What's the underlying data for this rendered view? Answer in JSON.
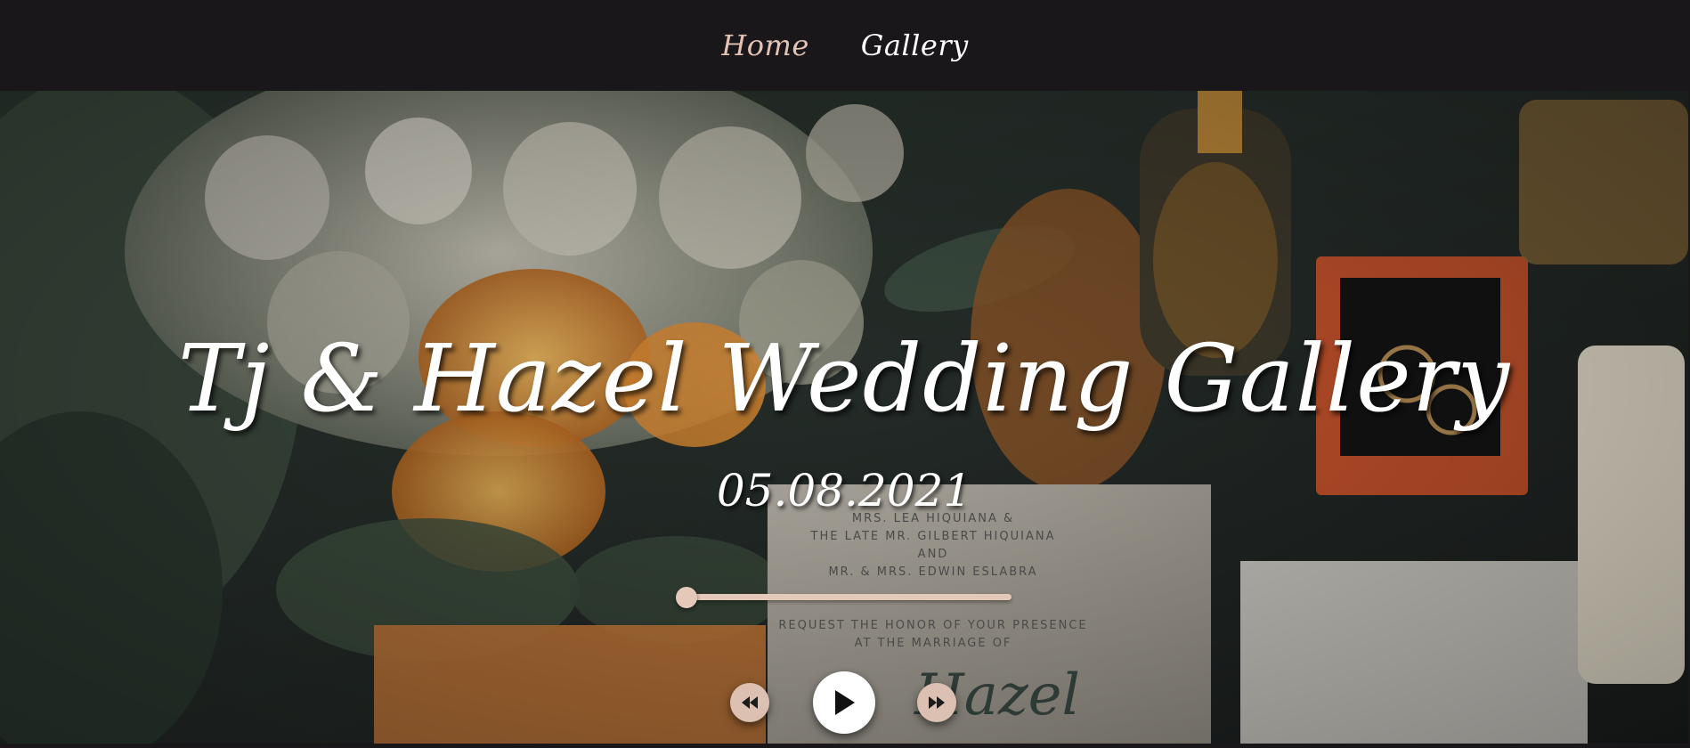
{
  "nav": {
    "items": [
      {
        "label": "Home"
      },
      {
        "label": "Gallery"
      }
    ]
  },
  "hero": {
    "title": "Tj & Hazel Wedding Gallery",
    "date": "05.08.2021",
    "background": "wedding-flatlay-photo",
    "invitation_text": [
      "MRS. LEA HIQUIANA &",
      "THE LATE MR. GILBERT HIQUIANA",
      "AND",
      "MR. & MRS. EDWIN ESLABRA",
      "REQUEST THE HONOR OF YOUR PRESENCE",
      "AT THE MARRIAGE OF",
      "Hazel"
    ]
  },
  "player": {
    "progress": 0.0,
    "buttons": {
      "rewind": "rewind-icon",
      "play": "play-icon",
      "forward": "fast-forward-icon"
    }
  },
  "colors": {
    "nav_bg": "#19171a",
    "accent": "#e2c3b4",
    "text": "#ffffff"
  }
}
